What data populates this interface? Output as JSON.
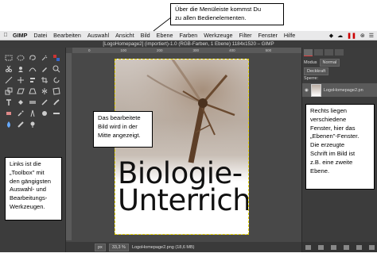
{
  "menubar": {
    "app": "GIMP",
    "items": [
      "Datei",
      "Bearbeiten",
      "Auswahl",
      "Ansicht",
      "Bild",
      "Ebene",
      "Farben",
      "Werkzeuge",
      "Filter",
      "Fenster",
      "Hilfe"
    ]
  },
  "window": {
    "title": "[LogoHomepage2] (importiert)-1.0 (RGB-Farben, 1 Ebene) 1184x1520 – GIMP"
  },
  "canvas": {
    "headline_line1": "Biologie-",
    "headline_line2": "Unterricht",
    "ruler_ticks": [
      "0",
      "100",
      "200",
      "300",
      "400",
      "500"
    ]
  },
  "statusbar": {
    "unit": "px",
    "zoom": "33,3 %",
    "file": "LogoHomepage2.png (18,6 MB)"
  },
  "dock": {
    "mode_label": "Modus",
    "mode_value": "Normal",
    "opacity_label": "Deckkraft",
    "lock_label": "Sperre:",
    "layer_name": "LogoHomepage2.pn"
  },
  "callouts": {
    "menu": [
      "Über die Menüleiste kommst Du",
      "zu allen Bedienelementen."
    ],
    "center": [
      "Das bearbeitete",
      "Bild wird in der",
      "Mitte angezeigt."
    ],
    "right": [
      "Rechts liegen",
      "verschiedene",
      "Fenster, hier das",
      "„Ebenen\"-Fenster.",
      "Die erzeugte",
      "Schrift im Bild ist",
      "z.B. eine zweite",
      "Ebene."
    ],
    "left": [
      "Links ist die",
      "„Toolbox\" mit",
      "den gängigsten",
      "Auswahl- und",
      "Bearbeitungs-",
      "Werkzeugen."
    ]
  },
  "colors": {
    "window_bg": "#454545",
    "panel_bg": "#3c3c3c",
    "selection_dash": "#e6d400"
  }
}
